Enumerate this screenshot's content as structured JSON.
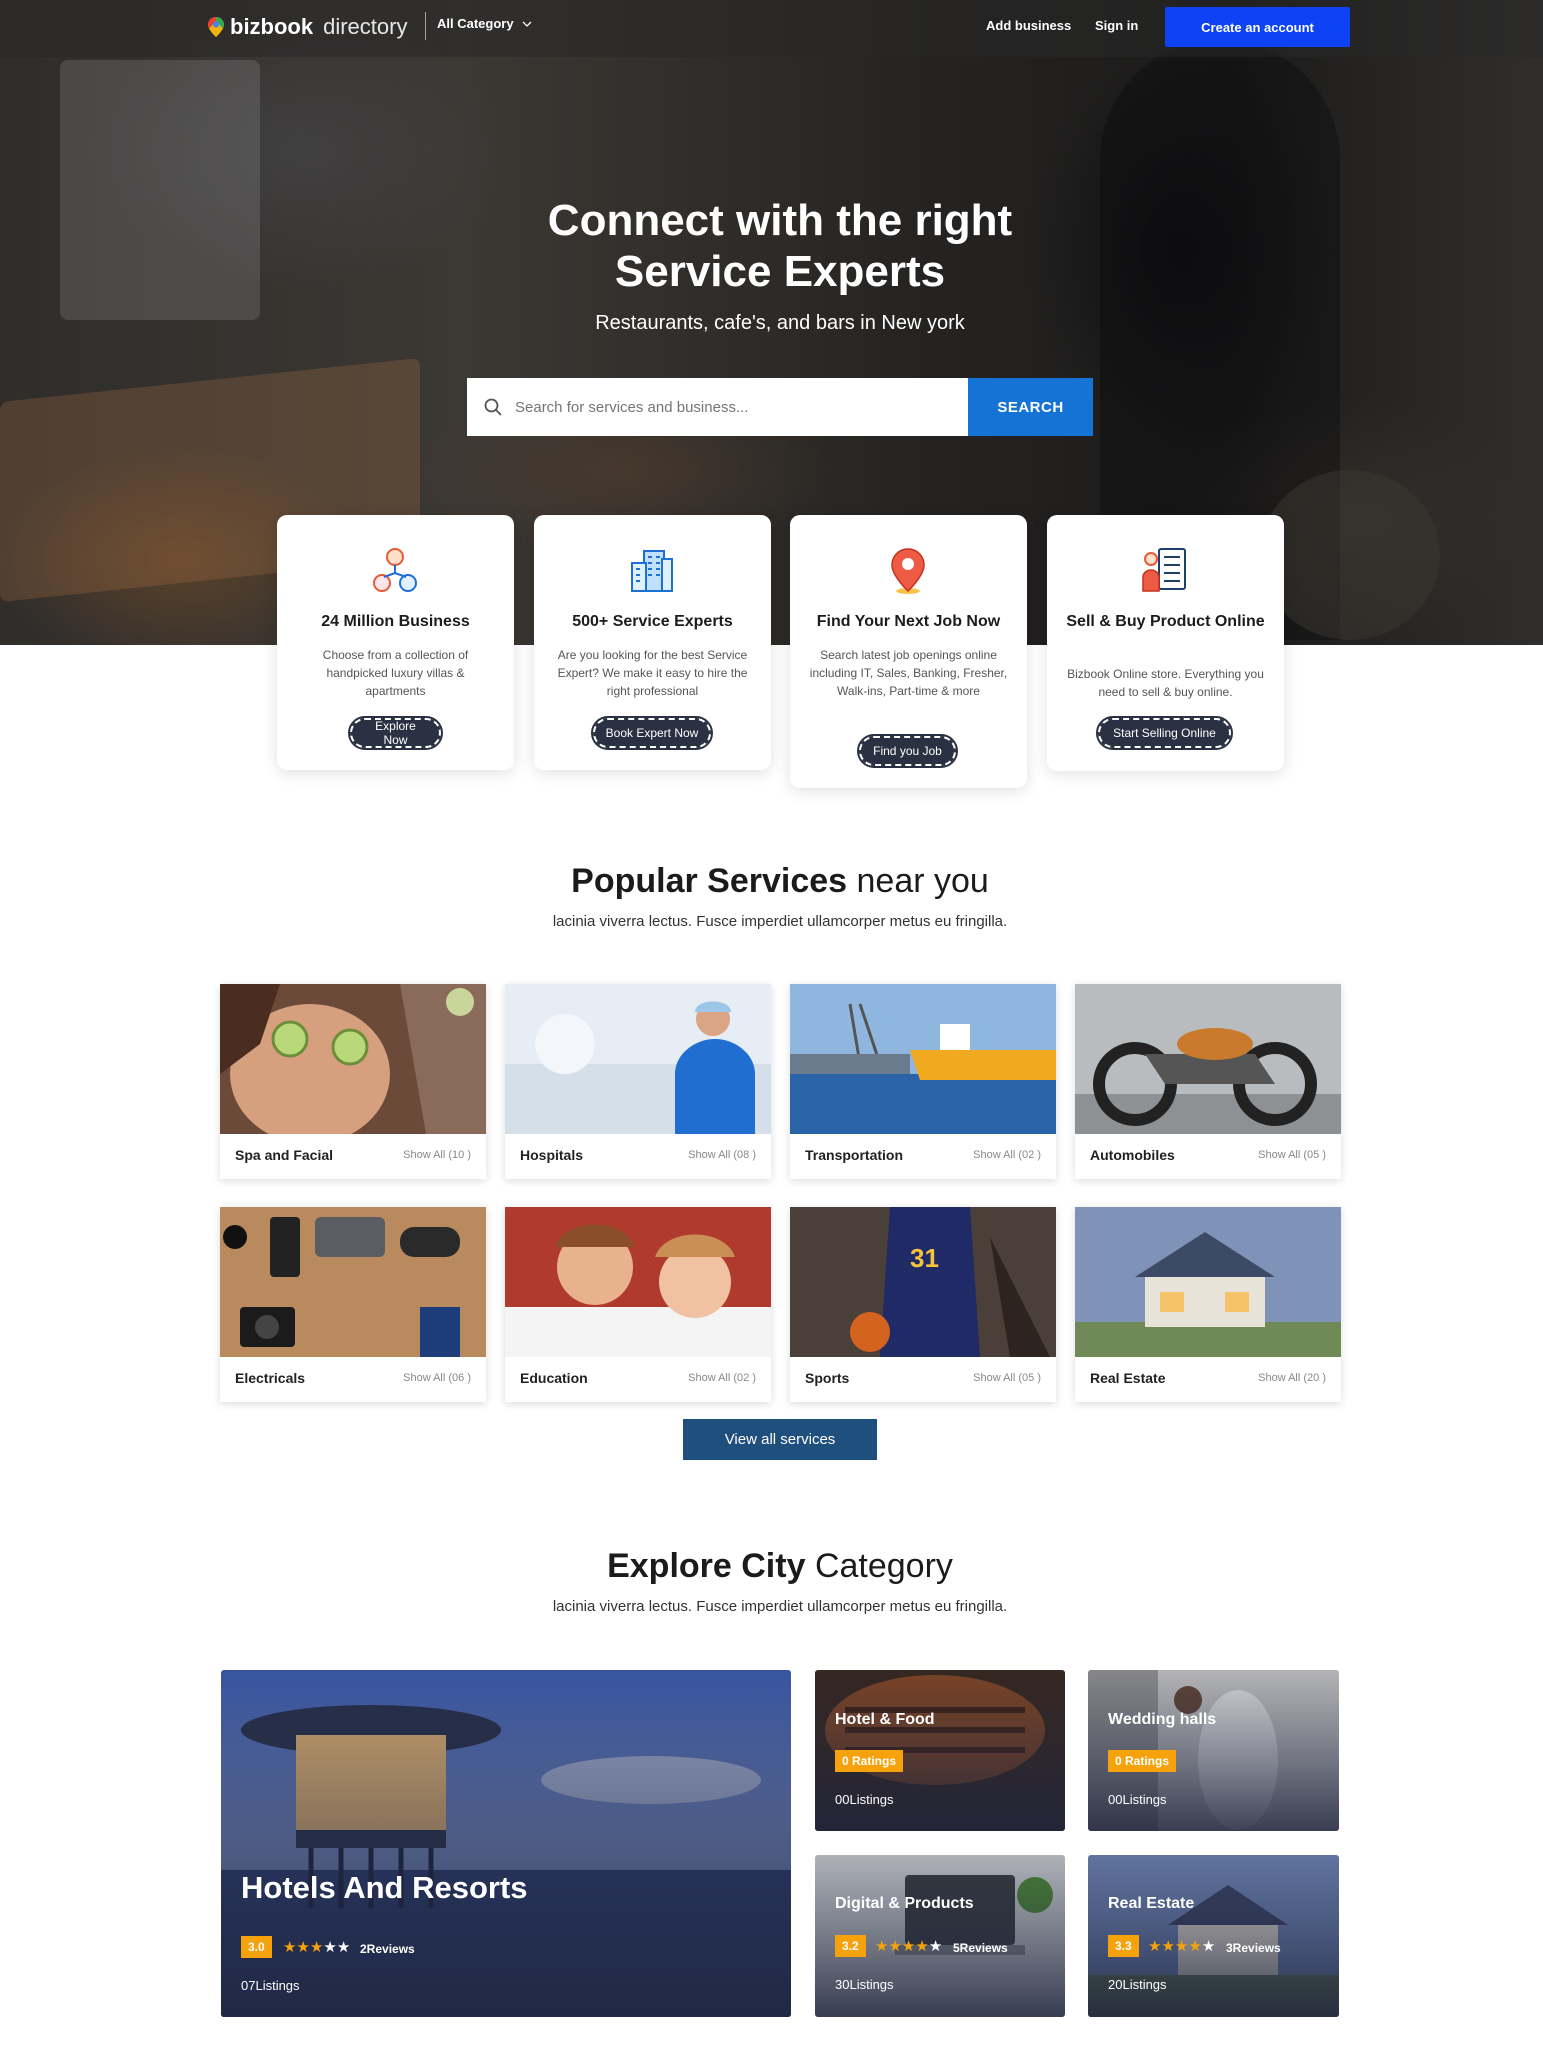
{
  "header": {
    "logo_bold": "bizbook",
    "logo_light": "directory",
    "category_label": "All Category",
    "add_business": "Add business",
    "sign_in": "Sign in",
    "create_account": "Create an account"
  },
  "hero": {
    "title_line1": "Connect with the right",
    "title_line2": "Service Experts",
    "subtitle": "Restaurants, cafe's, and bars in New york",
    "search_placeholder": "Search for services and business...",
    "search_button": "SEARCH"
  },
  "features": [
    {
      "title": "24 Million Business",
      "desc": "Choose from a collection of handpicked luxury villas & apartments",
      "button": "Explore Now",
      "icon": "people-network-icon"
    },
    {
      "title": "500+ Service Experts",
      "desc": "Are you looking for the best Service Expert? We make it easy to hire the right professional",
      "button": "Book Expert Now",
      "icon": "building-icon"
    },
    {
      "title": "Find Your Next Job Now",
      "desc": "Search latest job openings online including IT, Sales, Banking, Fresher, Walk-ins, Part-time & more",
      "button": "Find you Job",
      "icon": "map-pin-icon"
    },
    {
      "title": "Sell & Buy Product Online",
      "desc": "Bizbook Online store. Everything you need to sell & buy online.",
      "button": "Start Selling Online",
      "icon": "checklist-person-icon"
    }
  ],
  "popular": {
    "title_bold": "Popular Services",
    "title_light": "near you",
    "subtitle": "lacinia viverra lectus. Fusce imperdiet ullamcorper metus eu fringilla.",
    "services": [
      {
        "name": "Spa and Facial",
        "count": "Show All (10 )"
      },
      {
        "name": "Hospitals",
        "count": "Show All (08 )"
      },
      {
        "name": "Transportation",
        "count": "Show All (02 )"
      },
      {
        "name": "Automobiles",
        "count": "Show All (05 )"
      },
      {
        "name": "Electricals",
        "count": "Show All (06 )"
      },
      {
        "name": "Education",
        "count": "Show All (02 )"
      },
      {
        "name": "Sports",
        "count": "Show All (05 )"
      },
      {
        "name": "Real Estate",
        "count": "Show All (20 )"
      }
    ],
    "view_all": "View all services"
  },
  "city": {
    "title_bold": "Explore City",
    "title_light": "Category",
    "subtitle": "lacinia viverra lectus. Fusce imperdiet ullamcorper metus eu fringilla.",
    "big": {
      "title": "Hotels And Resorts",
      "rating": "3.0",
      "stars": 3,
      "reviews": "2Reviews",
      "listings": "07Listings"
    },
    "small": [
      {
        "title": "Hotel & Food",
        "rating": "0 Ratings",
        "listings": "00Listings"
      },
      {
        "title": "Wedding halls",
        "rating": "0 Ratings",
        "listings": "00Listings"
      },
      {
        "title": "Digital & Products",
        "rating": "3.2",
        "stars": 4,
        "reviews": "5Reviews",
        "listings": "30Listings"
      },
      {
        "title": "Real Estate",
        "rating": "3.3",
        "stars": 4,
        "reviews": "3Reviews",
        "listings": "20Listings"
      }
    ]
  },
  "colors": {
    "accent_blue": "#0d43f5",
    "search_blue": "#1673d6",
    "view_all_blue": "#1f4f7c",
    "rating_orange": "#f6a20c",
    "feature_button": "#2a3142"
  }
}
